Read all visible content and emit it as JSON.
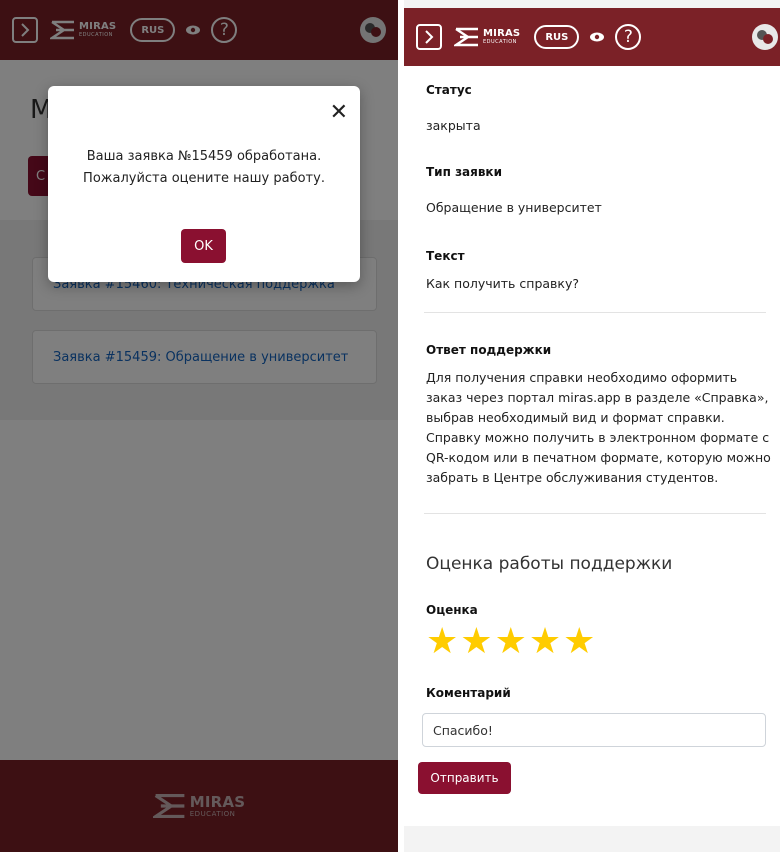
{
  "header": {
    "logo_big": "MIRAS",
    "logo_small": "EDUCATION",
    "lang": "RUS",
    "help": "?"
  },
  "left": {
    "page_title_initial": "М",
    "create_btn_initial": "С",
    "requests": [
      {
        "label": "Заявка #15460: Техническая поддержка"
      },
      {
        "label": "Заявка #15459: Обращение в университет"
      }
    ],
    "modal": {
      "line1": "Ваша заявка №15459 обработана.",
      "line2": "Пожалуйста оцените нашу работу.",
      "ok": "OK"
    }
  },
  "detail": {
    "status_label": "Статус",
    "status_value": "закрыта",
    "type_label": "Тип заявки",
    "type_value": "Обращение в университет",
    "text_label": "Текст",
    "text_value": "Как получить справку?",
    "answer_label": "Ответ поддержки",
    "answer_text": "Для получения справки необходимо оформить заказ через портал miras.app в разделе «Справка», выбрав необходимый вид и формат справки. Справку можно получить в электронном формате с QR-кодом или в печатном формате, которую можно забрать в Центре обслуживания студентов.",
    "rating_heading": "Оценка работы поддержки",
    "rating_label": "Оценка",
    "rating_value": 5,
    "rating_max": 5,
    "comment_label": "Коментарий",
    "comment_value": "Спасибо!",
    "submit": "Отправить"
  },
  "colors": {
    "brand": "#7b2127",
    "button": "#8a1030",
    "star": "#ffcc00",
    "link": "#1565c0"
  }
}
